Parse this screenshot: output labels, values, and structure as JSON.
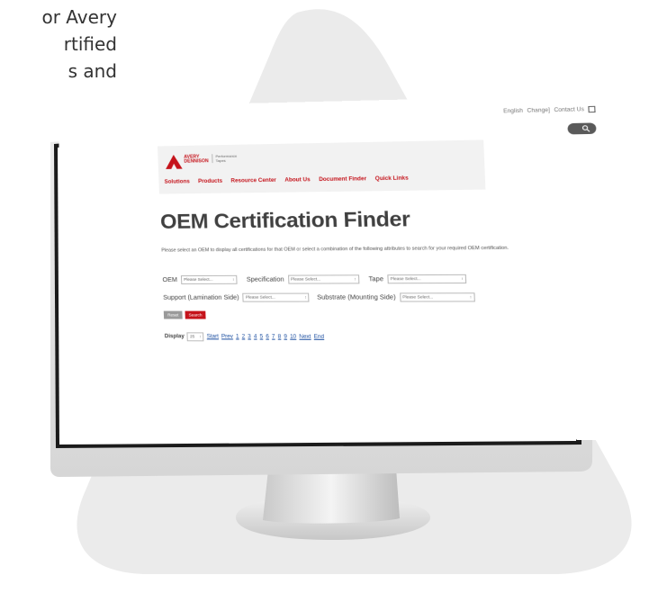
{
  "intro": {
    "lines": [
      "or Avery",
      "rtified",
      "s and"
    ]
  },
  "site": {
    "topbar": {
      "language": "English",
      "change": "Change]",
      "contact": "Contact Us"
    },
    "logo_line1": "AVERY",
    "logo_line2": "DENNISON",
    "tagline_line1": "Performance",
    "tagline_line2": "Tapes",
    "nav": [
      "Solutions",
      "Products",
      "Resource Center",
      "About Us",
      "Document Finder",
      "Quick Links"
    ],
    "title": "OEM Certification Finder",
    "description": "Please select an OEM to display all certifications for that OEM or select a combination of the following attributes to search for your required OEM certification.",
    "filters": {
      "oem_label": "OEM",
      "spec_label": "Specification",
      "tape_label": "Tape",
      "support_label": "Support (Lamination Side)",
      "substrate_label": "Substrate (Mounting Side)",
      "placeholder": "Please Select..."
    },
    "buttons": {
      "reset": "Reset",
      "search": "Search"
    },
    "pager": {
      "display_label": "Display",
      "display_value": "25",
      "start": "Start",
      "prev": "Prev",
      "pages": [
        "1",
        "2",
        "3",
        "4",
        "5",
        "6",
        "7",
        "8",
        "9",
        "10"
      ],
      "next": "Next",
      "end": "End"
    }
  },
  "colors": {
    "brand_red": "#c5131b",
    "link_blue": "#1b4ea0",
    "blob_gray": "#ebebeb"
  }
}
